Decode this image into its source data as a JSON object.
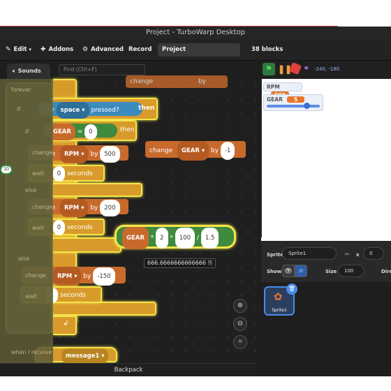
{
  "window": {
    "title": "Project - TurboWarp Desktop"
  },
  "menubar": {
    "edit": "Edit",
    "addons": "Addons",
    "advanced": "Advanced",
    "record": "Record",
    "project_title": "Project",
    "block_count": "38 blocks"
  },
  "tabs": {
    "sounds": "Sounds"
  },
  "find": {
    "placeholder": "Find (Ctrl+F)"
  },
  "palette": {
    "forever": "forever",
    "if": "if",
    "else": "else",
    "change": "change",
    "wait": "wait",
    "when_i_receive": "when I receive",
    "reporter_value": "10"
  },
  "script": {
    "key_label": "key",
    "key_value": "space",
    "pressed": "pressed?",
    "then1": "then",
    "gear_var": "GEAR",
    "eq": "=",
    "zero": "0",
    "then2": "then",
    "change1": "change",
    "rpm1": "RPM",
    "by1": "by",
    "val500": "500",
    "wait1": "wait",
    "wait1_val": "0",
    "seconds1": "seconds",
    "else_lbl": "else",
    "change2": "change",
    "rpm2": "RPM",
    "by2": "by",
    "val200": "200",
    "wait2": "wait",
    "wait2_val": "0",
    "seconds2": "seconds",
    "change3": "change",
    "rpm3": "RPM",
    "by3": "by",
    "val_neg150": "-150",
    "wait3": "wait",
    "seconds3": "seconds",
    "change_gear": "change",
    "gear2": "GEAR",
    "by4": "by",
    "val_neg1": "-1",
    "top_change": "change",
    "top_by": "by",
    "expr_gear": "GEAR",
    "expr_op1": "*",
    "expr_2": "2",
    "expr_op2": "*",
    "expr_100": "100",
    "expr_op3": "/",
    "expr_15": "1.5",
    "result": "666.6666666666666",
    "message": "message1"
  },
  "stage": {
    "coords": "-240, -180",
    "monitor_rpm_label": "RPM",
    "monitor_rpm_value": "500",
    "monitor_gear_label": "GEAR",
    "monitor_gear_value": "5",
    "monitor_gear_slider": 0.7
  },
  "sprite": {
    "sprite_label": "Sprite",
    "sprite_name": "Sprite1",
    "x_label": "x",
    "x_value": "0",
    "show_label": "Show",
    "size_label": "Size",
    "size_value": "100",
    "direction_label": "Direc",
    "thumb_name": "Sprite1"
  },
  "bottom": {
    "backpack": "Backpack"
  },
  "colors": {
    "accent": "#e8742c",
    "control": "#d89b2b",
    "highlight": "#f5e54a",
    "operator": "#3e8a3e",
    "sensing": "#3c8bbd"
  }
}
